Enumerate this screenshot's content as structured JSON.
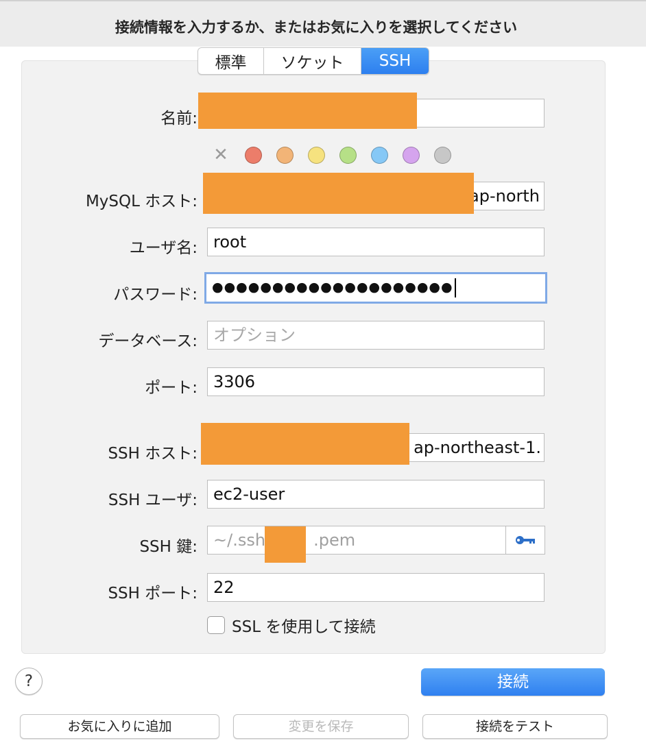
{
  "header": {
    "title": "接続情報を入力するか、またはお気に入りを選択してください"
  },
  "tabs": [
    {
      "label": "標準",
      "active": false
    },
    {
      "label": "ソケット",
      "active": false
    },
    {
      "label": "SSH",
      "active": true
    }
  ],
  "form": {
    "name": {
      "label": "名前:",
      "value": ""
    },
    "color_tags": {
      "clear_icon": "x-icon",
      "colors": [
        "#ec7d6a",
        "#f2b477",
        "#f6e27f",
        "#b6e087",
        "#86c8f6",
        "#d5a4ee",
        "#c7c7c7"
      ]
    },
    "mysql_host": {
      "label": "MySQL ホスト:",
      "value": "ap-north"
    },
    "user": {
      "label": "ユーザ名:",
      "value": "root"
    },
    "password": {
      "label": "パスワード:",
      "value": "●●●●●●●●●●●●●●●●●●●●"
    },
    "database": {
      "label": "データベース:",
      "value": "",
      "placeholder": "オプション"
    },
    "port": {
      "label": "ポート:",
      "value": "3306"
    },
    "ssh_host": {
      "label": "SSH ホスト:",
      "value": "ap-northeast-1."
    },
    "ssh_user": {
      "label": "SSH ユーザ:",
      "value": "ec2-user"
    },
    "ssh_key": {
      "label": "SSH 鍵:",
      "value_prefix": "~/.ssh/",
      "value_suffix": ".pem",
      "button_icon": "key-icon"
    },
    "ssh_port": {
      "label": "SSH ポート:",
      "value": "22"
    },
    "ssl": {
      "label": "SSL を使用して接続",
      "checked": false
    }
  },
  "help": {
    "label": "?"
  },
  "actions": {
    "connect": "接続",
    "add_favorite": "お気に入りに追加",
    "save_changes": "変更を保存",
    "test_connection": "接続をテスト"
  },
  "colors": {
    "accent": "#2f80f0",
    "redaction": "#f39a38"
  }
}
